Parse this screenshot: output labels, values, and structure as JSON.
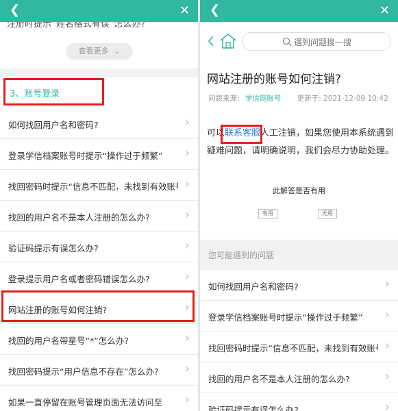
{
  "left": {
    "cut_off_question": "注册时提示“姓名格式有误”怎么办?",
    "more_button": "查看更多",
    "section_title": "3、账号登录",
    "questions": [
      "如何找回用户名和密码?",
      "登录学信档案账号时提示“操作过于频繁”",
      "找回密码时提示“信息不匹配，未找到有效账号”",
      "找回的用户名不是本人注册的怎么办?",
      "验证码提示有误怎么办?",
      "登录提示用户名或者密码错误怎么办?",
      "网站注册的账号如何注销?",
      "找回的用户名带星号“*”怎么办?",
      "找回密码提示“用户信息不存在”怎么办?",
      "如果一直停留在账号管理页面无法访问至"
    ]
  },
  "right": {
    "search_placeholder": "遇到问题搜一搜",
    "article_title": "网站注册的账号如何注销?",
    "source_label": "问题来源:",
    "source_value": "学信网账号",
    "updated_label": "更新于:",
    "updated_value": "2021-12-09 10:42",
    "body_pre": "可以",
    "body_link": "联系客服",
    "body_post": "人工注销，如果您使用本系统遇到疑难问题，请明确说明，我们会尽力协助处理。",
    "helpful_question": "此解答是否有用",
    "helpful_yes": "有用",
    "helpful_no": "无用",
    "related_header": "您可能遇到的问题",
    "related": [
      "如何找回用户名和密码?",
      "登录学信档案账号时提示“操作过于频繁”",
      "找回密码时提示“信息不匹配，未找到有效账号”",
      "找回的用户名不是本人注册的怎么办?",
      "验证码提示有误怎么办?"
    ]
  },
  "colors": {
    "topbar": "#32b7a0",
    "highlight_border": "#e51d1d",
    "link": "#2d7bd8"
  },
  "icons": [
    "back-chevron-icon",
    "close-icon",
    "chevron-down-icon",
    "chevron-right-icon",
    "home-icon",
    "search-icon"
  ]
}
